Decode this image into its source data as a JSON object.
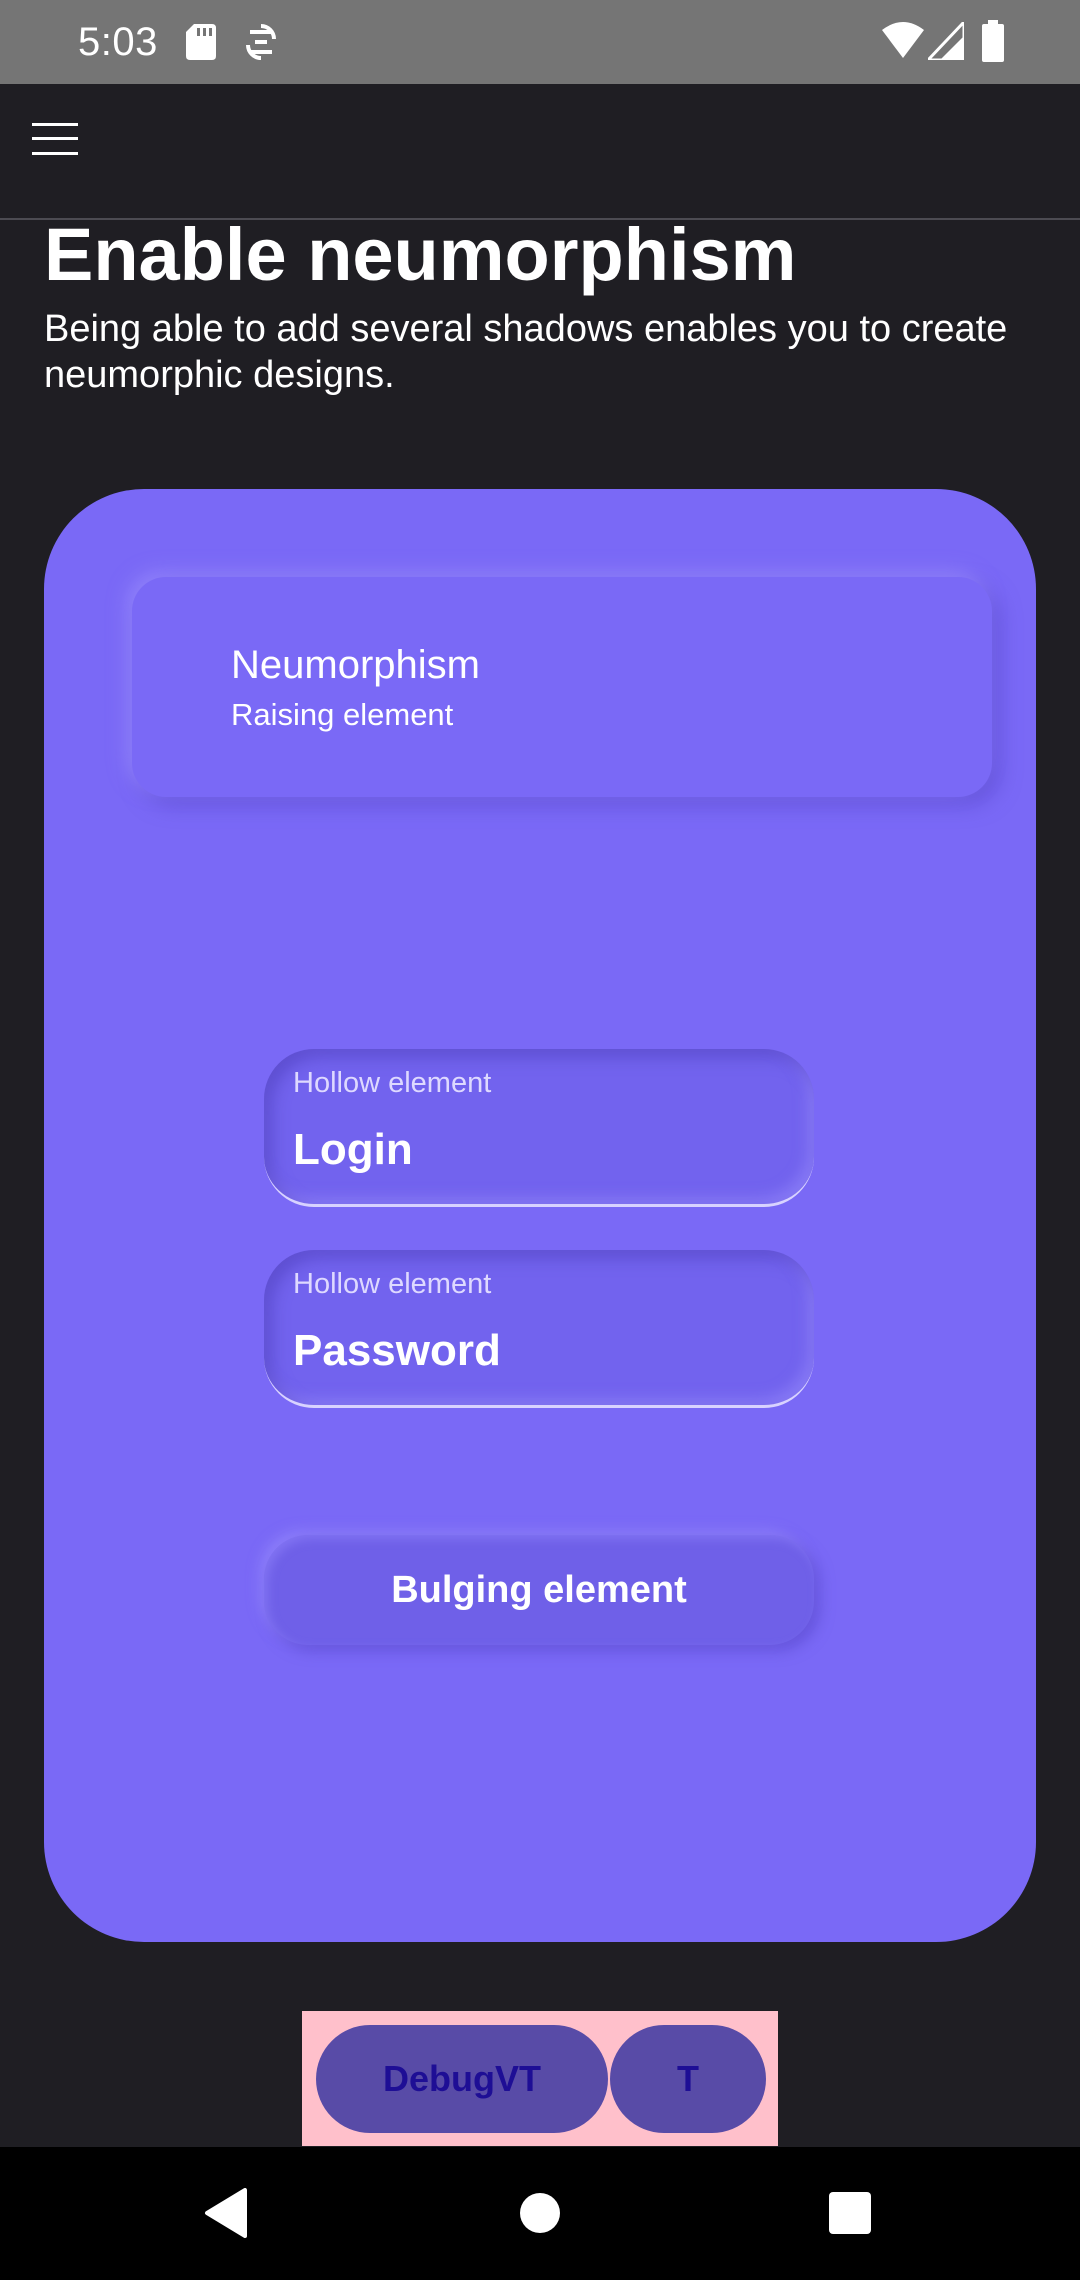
{
  "status_bar": {
    "time": "5:03",
    "icons": [
      "sd-card-icon",
      "sync-icon",
      "wifi-icon",
      "cellular-signal-icon",
      "battery-icon"
    ]
  },
  "app_bar": {
    "menu_icon": "hamburger-menu-icon"
  },
  "header": {
    "title": "Enable neumorphism",
    "subtitle": "Being able to add several shadows enables you to create neumorphic designs."
  },
  "card": {
    "background": "#7a69f6",
    "raised": {
      "title": "Neumorphism",
      "subtitle": "Raising element"
    },
    "login_field": {
      "label": "Hollow element",
      "value": "Login"
    },
    "password_field": {
      "label": "Hollow element",
      "value": "Password"
    },
    "bulging_button": {
      "label": "Bulging element"
    }
  },
  "debug": {
    "debug_label": "DebugVT",
    "t_label": "T"
  },
  "nav_bar": {
    "back_icon": "back-triangle-icon",
    "home_icon": "home-circle-icon",
    "recents_icon": "recents-square-icon"
  }
}
